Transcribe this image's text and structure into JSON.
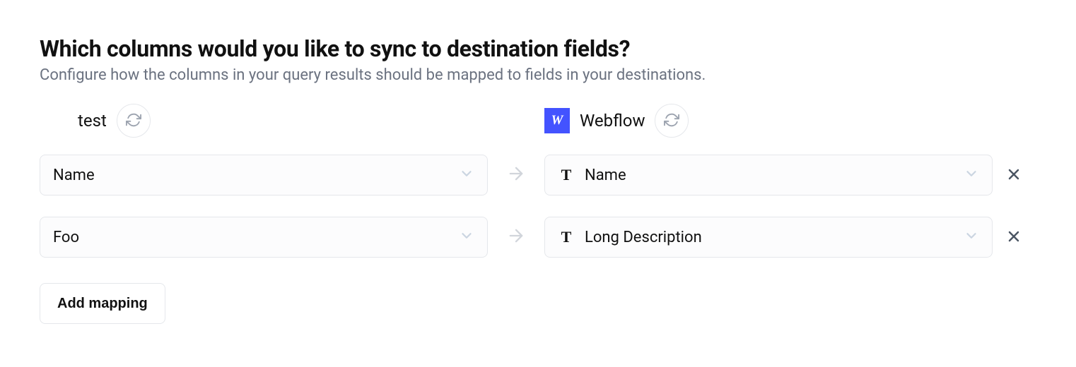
{
  "header": {
    "title": "Which columns would you like to sync to destination fields?",
    "subtitle": "Configure how the columns in your query results should be mapped to fields in your destinations."
  },
  "source": {
    "label": "test"
  },
  "destination": {
    "label": "Webflow",
    "logo_letter": "W"
  },
  "mappings": [
    {
      "source_field": "Name",
      "dest_field": "Name",
      "dest_type_glyph": "T"
    },
    {
      "source_field": "Foo",
      "dest_field": "Long Description",
      "dest_type_glyph": "T"
    }
  ],
  "actions": {
    "add_mapping": "Add mapping"
  }
}
